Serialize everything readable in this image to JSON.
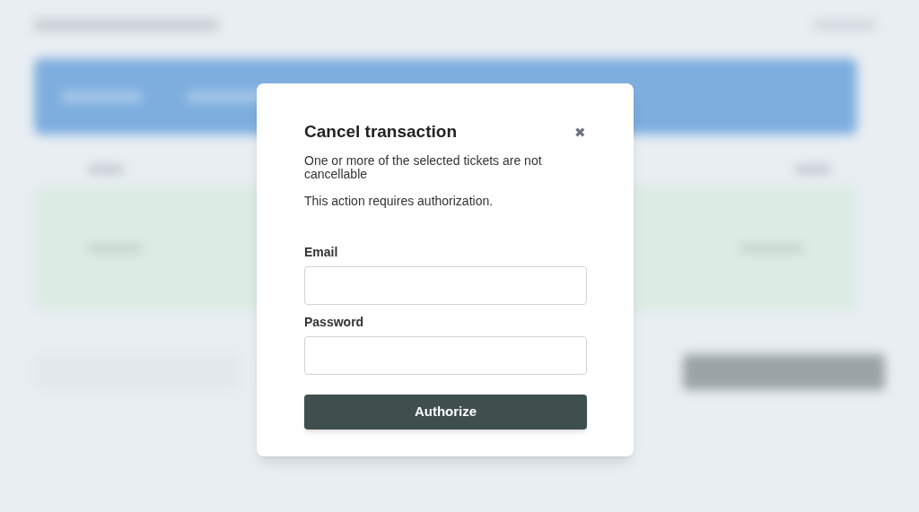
{
  "dialog": {
    "title": "Cancel transaction",
    "close": "✖",
    "message": "One or more of the selected tickets are not cancellable",
    "note": "This action requires authorization.",
    "fields": [
      {
        "label": "Email"
      },
      {
        "label": "Password"
      }
    ],
    "submit": "Authorize"
  }
}
